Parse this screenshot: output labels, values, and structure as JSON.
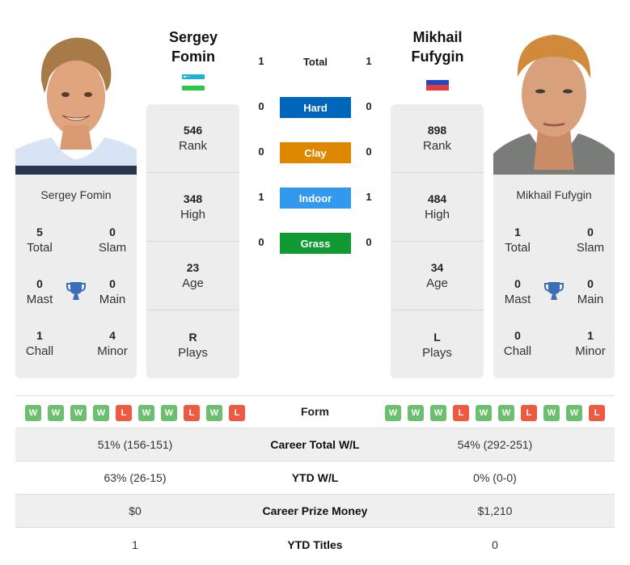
{
  "players": {
    "left": {
      "name_line1": "Sergey",
      "name_line2": "Fomin",
      "full_name": "Sergey Fomin",
      "flag": "uzbekistan-flag",
      "stats": [
        {
          "value": "546",
          "label": "Rank"
        },
        {
          "value": "348",
          "label": "High"
        },
        {
          "value": "23",
          "label": "Age"
        },
        {
          "value": "R",
          "label": "Plays"
        }
      ],
      "titles": {
        "total": {
          "value": "5",
          "label": "Total"
        },
        "slam": {
          "value": "0",
          "label": "Slam"
        },
        "mast": {
          "value": "0",
          "label": "Mast"
        },
        "main": {
          "value": "0",
          "label": "Main"
        },
        "chall": {
          "value": "1",
          "label": "Chall"
        },
        "minor": {
          "value": "4",
          "label": "Minor"
        }
      },
      "form": [
        "W",
        "W",
        "W",
        "W",
        "L",
        "W",
        "W",
        "L",
        "W",
        "L"
      ]
    },
    "right": {
      "name_line1": "Mikhail",
      "name_line2": "Fufygin",
      "full_name": "Mikhail Fufygin",
      "flag": "russia-flag",
      "stats": [
        {
          "value": "898",
          "label": "Rank"
        },
        {
          "value": "484",
          "label": "High"
        },
        {
          "value": "34",
          "label": "Age"
        },
        {
          "value": "L",
          "label": "Plays"
        }
      ],
      "titles": {
        "total": {
          "value": "1",
          "label": "Total"
        },
        "slam": {
          "value": "0",
          "label": "Slam"
        },
        "mast": {
          "value": "0",
          "label": "Mast"
        },
        "main": {
          "value": "0",
          "label": "Main"
        },
        "chall": {
          "value": "0",
          "label": "Chall"
        },
        "minor": {
          "value": "1",
          "label": "Minor"
        }
      },
      "form": [
        "W",
        "W",
        "W",
        "L",
        "W",
        "W",
        "L",
        "W",
        "W",
        "L"
      ]
    }
  },
  "h2h": {
    "total": {
      "label": "Total",
      "left": "1",
      "right": "1"
    },
    "surfaces": [
      {
        "label": "Hard",
        "left": "0",
        "right": "0",
        "color": "#0066bb"
      },
      {
        "label": "Clay",
        "left": "0",
        "right": "0",
        "color": "#dd8800"
      },
      {
        "label": "Indoor",
        "left": "1",
        "right": "1",
        "color": "#3399ee"
      },
      {
        "label": "Grass",
        "left": "0",
        "right": "0",
        "color": "#119933"
      }
    ]
  },
  "form_label": "Form",
  "comparison": [
    {
      "label": "Career Total W/L",
      "left": "51% (156-151)",
      "right": "54% (292-251)"
    },
    {
      "label": "YTD W/L",
      "left": "63% (26-15)",
      "right": "0% (0-0)"
    },
    {
      "label": "Career Prize Money",
      "left": "$0",
      "right": "$1,210"
    },
    {
      "label": "YTD Titles",
      "left": "1",
      "right": "0"
    }
  ],
  "colors": {
    "win": "#6cbf6e",
    "loss": "#ee5a40",
    "trophy": "#3a6fb8",
    "card_bg": "#ededed"
  }
}
